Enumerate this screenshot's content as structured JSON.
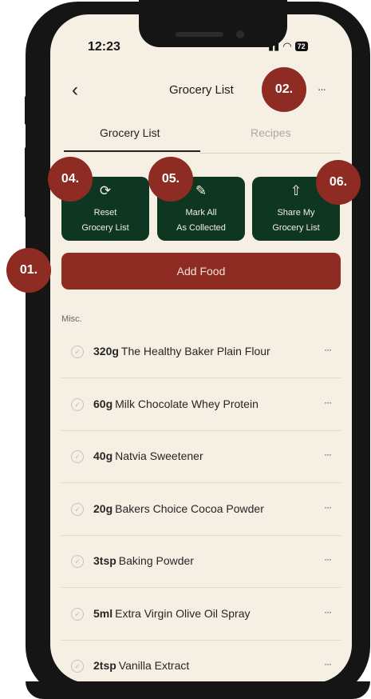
{
  "status": {
    "time": "12:23",
    "battery": "72"
  },
  "header": {
    "back_icon": "chevron-left-icon",
    "title": "Grocery List",
    "more": "···"
  },
  "tabs": [
    {
      "label": "Grocery List",
      "active": true
    },
    {
      "label": "Recipes",
      "active": false
    }
  ],
  "actions": [
    {
      "icon": "refresh-icon",
      "line1": "Reset",
      "line2": "Grocery List"
    },
    {
      "icon": "pencil-icon",
      "line1": "Mark All",
      "line2": "As Collected"
    },
    {
      "icon": "share-icon",
      "line1": "Share My",
      "line2": "Grocery List"
    }
  ],
  "add_food_label": "Add Food",
  "badges": {
    "b01": "01.",
    "b02": "02.",
    "b04": "04.",
    "b05": "05.",
    "b06": "06."
  },
  "section_label": "Misc.",
  "items": [
    {
      "qty": "320g",
      "name": "The Healthy Baker Plain Flour"
    },
    {
      "qty": "60g",
      "name": "Milk Chocolate Whey Protein"
    },
    {
      "qty": "40g",
      "name": "Natvia Sweetener"
    },
    {
      "qty": "20g",
      "name": "Bakers Choice Cocoa Powder"
    },
    {
      "qty": "3tsp",
      "name": "Baking Powder"
    },
    {
      "qty": "5ml",
      "name": "Extra Virgin Olive Oil Spray"
    },
    {
      "qty": "2tsp",
      "name": "Vanilla Extract"
    }
  ],
  "colors": {
    "accent_red": "#8e2b22",
    "dark_green": "#0f3621",
    "background": "#f6efe4"
  }
}
